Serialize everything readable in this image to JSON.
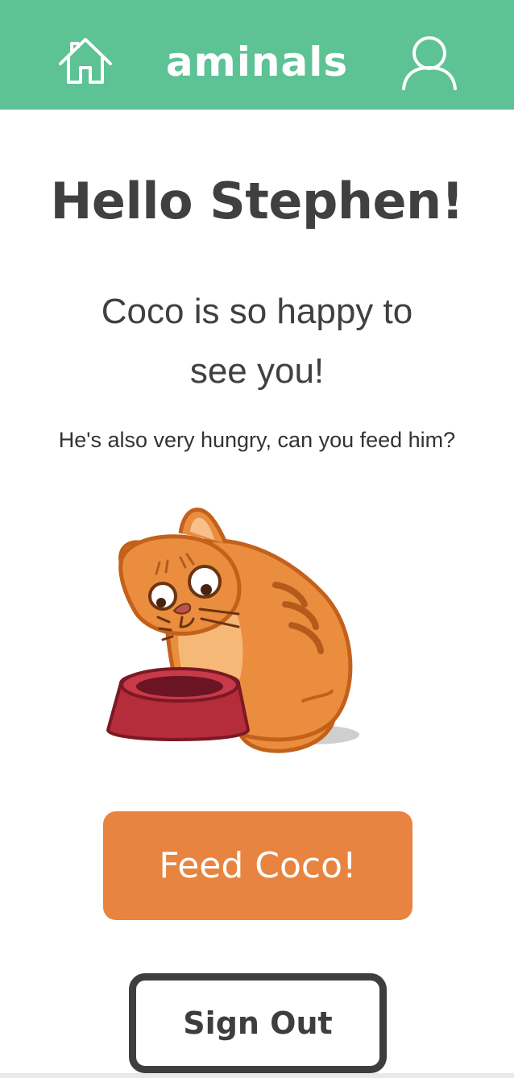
{
  "header": {
    "brand": "aminals",
    "home_icon": "home-icon",
    "profile_icon": "user-icon",
    "background_color": "#5dc294"
  },
  "main": {
    "greeting": "Hello Stephen!",
    "happy_message": "Coco is so happy to see you!",
    "hungry_message": "He's also very hungry, can you feed him?",
    "illustration_icon": "cat-with-empty-bowl-illustration"
  },
  "actions": {
    "feed_label": "Feed Coco!",
    "feed_color": "#e8843f",
    "signout_label": "Sign Out",
    "signout_border_color": "#3e3e3e"
  }
}
